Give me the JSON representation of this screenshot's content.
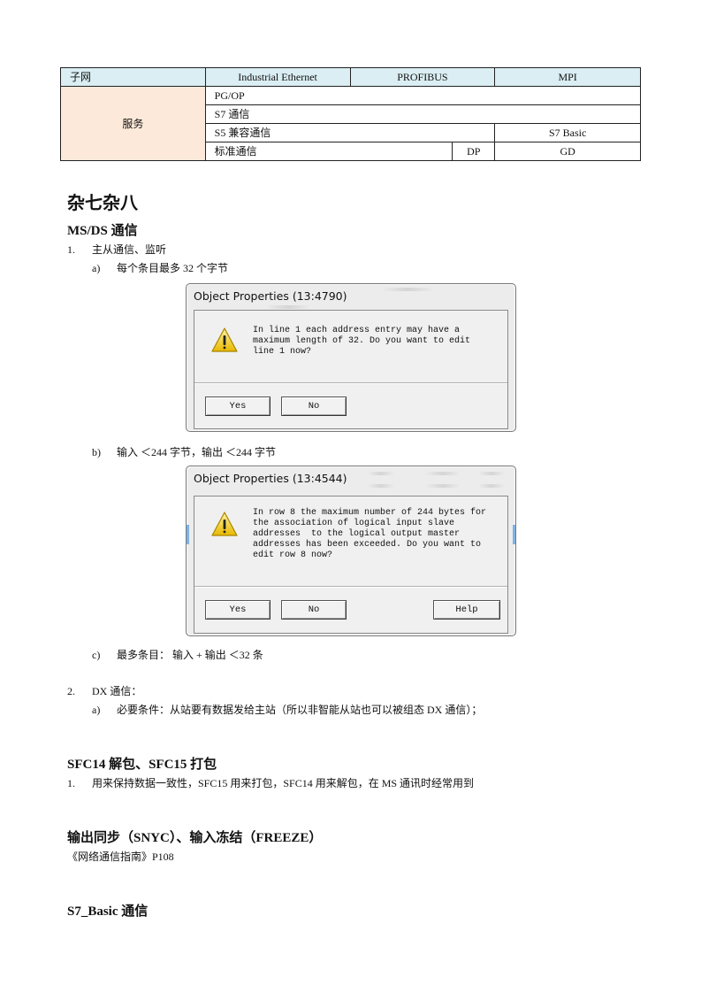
{
  "table": {
    "header": [
      "子网",
      "Industrial Ethernet",
      "PROFIBUS",
      "MPI"
    ],
    "service_label": "服务",
    "rows": {
      "pgop": "PG/OP",
      "s7": "S7 通信",
      "s5": "S5 兼容通信",
      "s7basic": "S7 Basic",
      "std": "标准通信",
      "dp": "DP",
      "gd": "GD"
    }
  },
  "section_title": "杂七杂八",
  "ms_ds": {
    "heading": "MS/DS 通信",
    "item1": {
      "num": "1.",
      "text": "主从通信、监听"
    },
    "item1a": {
      "num": "a)",
      "text": "每个条目最多 32 个字节"
    },
    "item1b": {
      "num": "b)",
      "text": "输入 ＜244 字节，输出 ＜244 字节"
    },
    "item1c": {
      "num": "c)",
      "text": "最多条目：  输入 + 输出 ＜32  条"
    },
    "item2": {
      "num": "2.",
      "text": "DX 通信："
    },
    "item2a": {
      "num": "a)",
      "text": "必要条件：从站要有数据发给主站（所以非智能从站也可以被组态 DX 通信）；"
    }
  },
  "dialog1": {
    "title": "Object Properties (13:4790)",
    "message": "In line 1 each address entry may have a\nmaximum length of 32. Do you want to edit\nline 1 now?",
    "buttons": {
      "yes": "Yes",
      "no": "No"
    },
    "icon": "warning-icon"
  },
  "dialog2": {
    "title": "Object Properties (13:4544)",
    "message": "In row 8 the maximum number of 244 bytes for\nthe association of logical input slave\naddresses  to the logical output master\naddresses has been exceeded. Do you want to\nedit row 8 now?",
    "buttons": {
      "yes": "Yes",
      "no": "No",
      "help": "Help"
    },
    "icon": "warning-icon"
  },
  "sfc": {
    "heading": "SFC14 解包、SFC15 打包",
    "item1": {
      "num": "1.",
      "text": "用来保持数据一致性，SFC15 用来打包，SFC14 用来解包，在 MS 通讯时经常用到"
    }
  },
  "sync": {
    "heading": "输出同步（SNYC）、输入冻结（FREEZE）",
    "ref": "《网络通信指南》P108"
  },
  "s7basic": {
    "heading": "S7_Basic 通信"
  }
}
